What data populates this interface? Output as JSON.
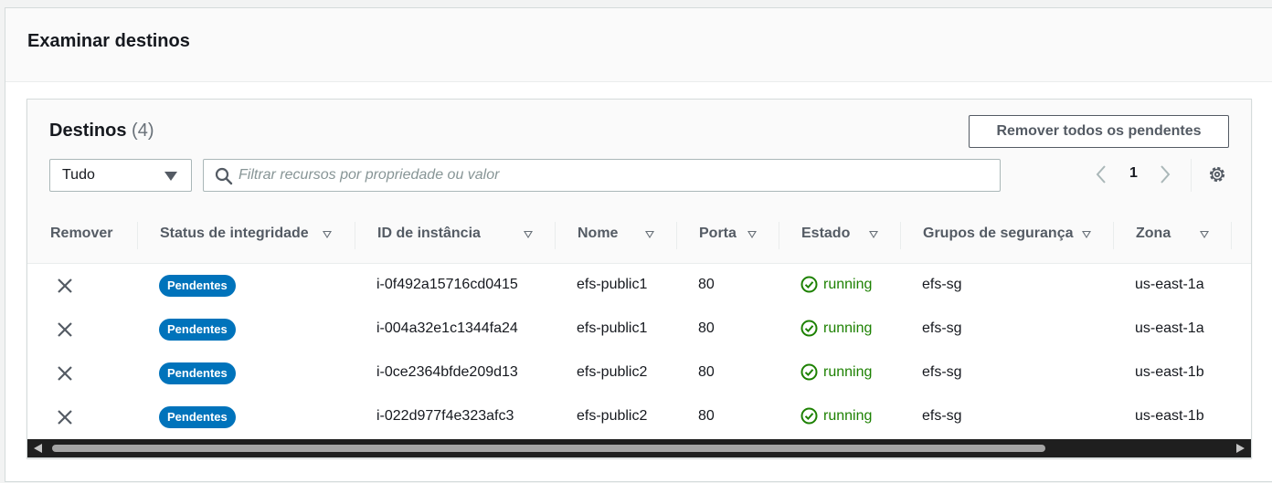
{
  "panel": {
    "title": "Examinar destinos"
  },
  "targets": {
    "title": "Destinos",
    "count": "(4)",
    "remove_all_label": "Remover todos os pendentes",
    "filter_select": {
      "value": "Tudo"
    },
    "search": {
      "placeholder": "Filtrar recursos por propriedade ou valor"
    },
    "pagination": {
      "current_page": "1"
    },
    "columns": {
      "remove": "Remover",
      "health": "Status de integridade",
      "instance_id": "ID de instância",
      "name": "Nome",
      "port": "Porta",
      "state": "Estado",
      "security_groups": "Grupos de segurança",
      "zone": "Zona"
    },
    "rows": [
      {
        "health": "Pendentes",
        "instance_id": "i-0f492a15716cd0415",
        "name": "efs-public1",
        "port": "80",
        "state": "running",
        "security_groups": "efs-sg",
        "zone": "us-east-1a"
      },
      {
        "health": "Pendentes",
        "instance_id": "i-004a32e1c1344fa24",
        "name": "efs-public1",
        "port": "80",
        "state": "running",
        "security_groups": "efs-sg",
        "zone": "us-east-1a"
      },
      {
        "health": "Pendentes",
        "instance_id": "i-0ce2364bfde209d13",
        "name": "efs-public2",
        "port": "80",
        "state": "running",
        "security_groups": "efs-sg",
        "zone": "us-east-1b"
      },
      {
        "health": "Pendentes",
        "instance_id": "i-022d977f4e323afc3",
        "name": "efs-public2",
        "port": "80",
        "state": "running",
        "security_groups": "efs-sg",
        "zone": "us-east-1b"
      }
    ]
  },
  "colors": {
    "badge": "#0073bb",
    "running": "#1d8102",
    "button_border": "#545b64",
    "scrollbar": "#1f1f1f"
  },
  "icons": {
    "remove": "close-icon",
    "state": "check-circle-icon",
    "search": "search-icon",
    "settings": "gear-icon",
    "prev": "chevron-left-icon",
    "next": "chevron-right-icon",
    "sort": "caret-down-icon"
  }
}
